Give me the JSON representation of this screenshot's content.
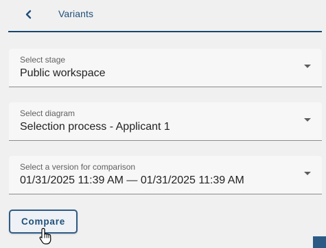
{
  "header": {
    "back_icon": "chevron-left-icon",
    "title": "Variants"
  },
  "fields": {
    "stage": {
      "label": "Select stage",
      "value": "Public workspace"
    },
    "diagram": {
      "label": "Select diagram",
      "value": "Selection process - Applicant 1"
    },
    "version": {
      "label": "Select a version for comparison",
      "value": "01/31/2025 11:39 AM — 01/31/2025 11:39 AM"
    }
  },
  "actions": {
    "compare_label": "Compare"
  },
  "colors": {
    "accent": "#1f4e79",
    "header_rule": "#16466e",
    "field_bg": "#f7f7f7",
    "page_bg": "#f0f0f0"
  },
  "icons": {
    "dropdown": "caret-down-icon",
    "cursor": "hand-pointer-icon"
  }
}
